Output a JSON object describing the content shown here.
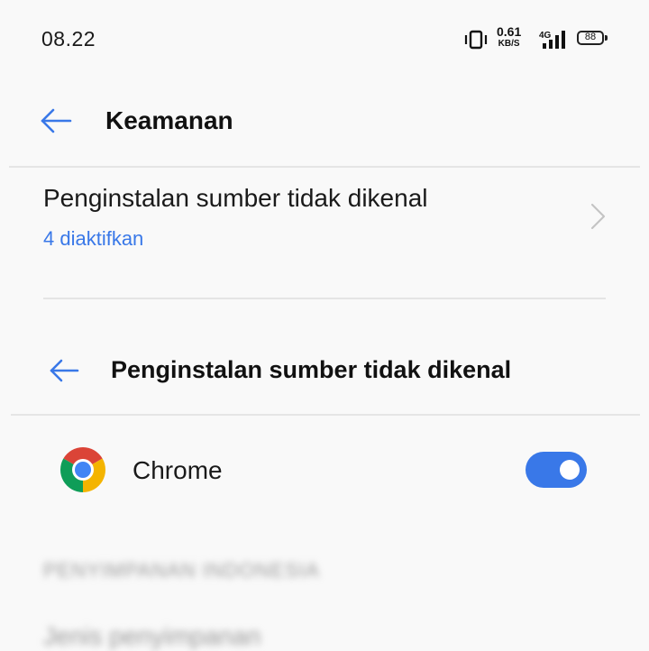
{
  "status_bar": {
    "time": "08.22",
    "net_speed_value": "0.61",
    "net_speed_unit": "KB/S",
    "network_type": "4G",
    "battery": "88"
  },
  "header": {
    "title": "Keamanan"
  },
  "settings_item": {
    "title": "Penginstalan sumber tidak dikenal",
    "subtitle": "4 diaktifkan"
  },
  "subpage": {
    "title": "Penginstalan sumber tidak dikenal"
  },
  "apps": [
    {
      "name": "Chrome",
      "enabled": true
    }
  ],
  "blurred": {
    "line1": "PENYIMPANAN INDONESIA",
    "line2": "Jenis penyimpanan"
  },
  "colors": {
    "accent": "#3978e8",
    "background": "#f9f9f9"
  }
}
